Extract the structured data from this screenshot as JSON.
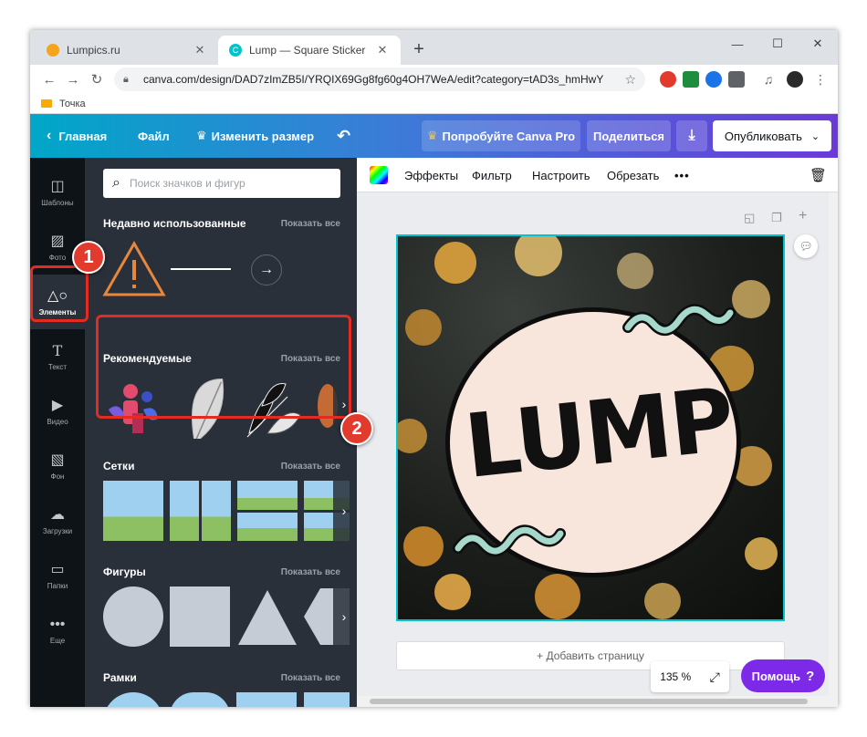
{
  "browser": {
    "tabs": [
      {
        "title": "Lumpics.ru",
        "color": "#f4a51c"
      },
      {
        "title": "Lump — Square Sticker",
        "color": "#00c4cc"
      }
    ],
    "url": "canva.com/design/DAD7zImZB5I/YRQIX69Gg8fg60g4OH7WeA/edit?category=tAD3s_hmHwY",
    "bookmark": "Точка"
  },
  "header": {
    "home": "Главная",
    "file": "Файл",
    "resize": "Изменить размер",
    "try_pro": "Попробуйте Canva Pro",
    "share": "Поделиться",
    "publish": "Опубликовать"
  },
  "rail": [
    {
      "label": "Шаблоны",
      "icon": "layout-icon"
    },
    {
      "label": "Фото",
      "icon": "photo-icon"
    },
    {
      "label": "Элементы",
      "icon": "elements-icon"
    },
    {
      "label": "Текст",
      "icon": "text-icon"
    },
    {
      "label": "Видео",
      "icon": "video-icon"
    },
    {
      "label": "Фон",
      "icon": "background-icon"
    },
    {
      "label": "Загрузки",
      "icon": "upload-icon"
    },
    {
      "label": "Папки",
      "icon": "folder-icon"
    },
    {
      "label": "Еще",
      "icon": "more-icon"
    }
  ],
  "panel": {
    "search_placeholder": "Поиск значков и фигур",
    "show_all": "Показать все",
    "sections": [
      "Недавно использованные",
      "Рекомендуемые",
      "Сетки",
      "Фигуры",
      "Рамки"
    ]
  },
  "toolbar": {
    "effects": "Эффекты",
    "filter": "Фильтр",
    "adjust": "Настроить",
    "crop": "Обрезать"
  },
  "canvas": {
    "text": "LUMP"
  },
  "footer": {
    "add_page": "+ Добавить страницу",
    "zoom": "135 %",
    "help": "Помощь"
  },
  "annotations": [
    "1",
    "2"
  ],
  "colors": {
    "accent": "#7d2ae8",
    "highlight": "#e32b22",
    "selection": "#00c4cc"
  }
}
